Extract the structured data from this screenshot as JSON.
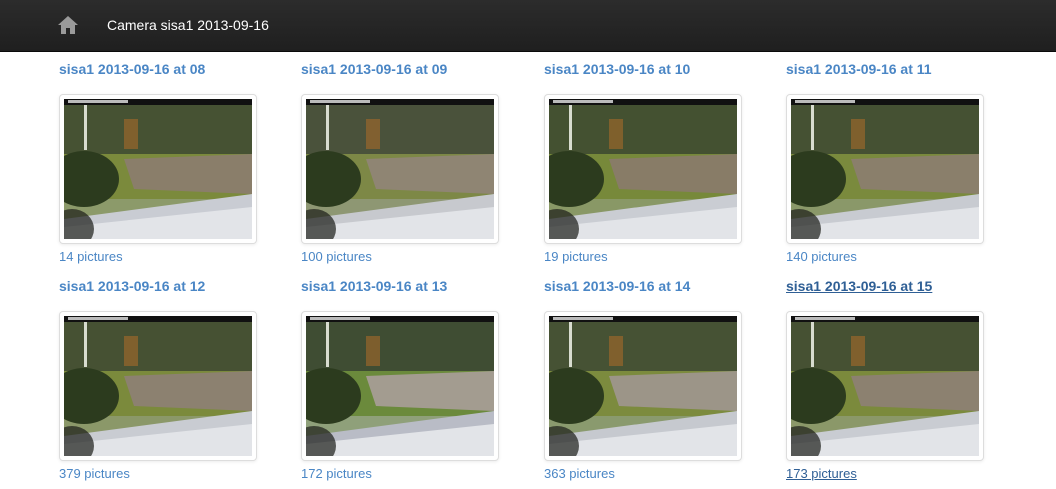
{
  "navbar": {
    "home_icon": "home-icon",
    "title": "Camera sisa1 2013-09-16"
  },
  "colors": {
    "navbar_bg": "#222222",
    "link": "#4a86c5",
    "link_hover": "#2f5f95"
  },
  "items": [
    {
      "title": "sisa1 2013-09-16 at 08",
      "count": "14 pictures",
      "hovered": false
    },
    {
      "title": "sisa1 2013-09-16 at 09",
      "count": "100 pictures",
      "hovered": false
    },
    {
      "title": "sisa1 2013-09-16 at 10",
      "count": "19 pictures",
      "hovered": false
    },
    {
      "title": "sisa1 2013-09-16 at 11",
      "count": "140 pictures",
      "hovered": false
    },
    {
      "title": "sisa1 2013-09-16 at 12",
      "count": "379 pictures",
      "hovered": false
    },
    {
      "title": "sisa1 2013-09-16 at 13",
      "count": "172 pictures",
      "hovered": false
    },
    {
      "title": "sisa1 2013-09-16 at 14",
      "count": "363 pictures",
      "hovered": false
    },
    {
      "title": "sisa1 2013-09-16 at 15",
      "count": "173 pictures",
      "hovered": true
    }
  ]
}
